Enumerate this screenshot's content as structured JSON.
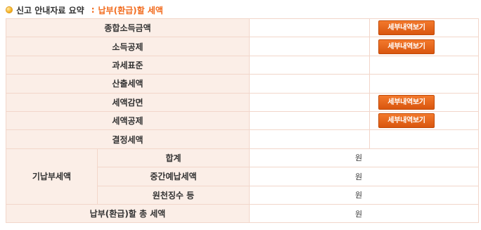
{
  "header": {
    "title": "신고 안내자료 요약",
    "separator": ":",
    "subtitle": "납부(환급)할 세액"
  },
  "detail_button_label": "세부내역보기",
  "rows": [
    {
      "label": "종합소득금액",
      "value": "",
      "has_detail": true
    },
    {
      "label": "소득공제",
      "value": "",
      "has_detail": true
    },
    {
      "label": "과세표준",
      "value": "",
      "has_detail": false
    },
    {
      "label": "산출세액",
      "value": "",
      "has_detail": false
    },
    {
      "label": "세액감면",
      "value": "",
      "has_detail": true
    },
    {
      "label": "세액공제",
      "value": "",
      "has_detail": true
    },
    {
      "label": "결정세액",
      "value": "",
      "has_detail": false
    }
  ],
  "prepaid": {
    "group_label": "기납부세액",
    "items": [
      {
        "label": "합계",
        "unit": "원"
      },
      {
        "label": "중간예납세액",
        "unit": "원"
      },
      {
        "label": "원천징수 등",
        "unit": "원"
      }
    ]
  },
  "total": {
    "label": "납부(환급)할 총 세액",
    "unit": "원"
  },
  "colors": {
    "accent": "#f26b1d",
    "label_bg": "#fbeee7",
    "border": "#f2d6ca",
    "button_bg": "#e4661d"
  }
}
